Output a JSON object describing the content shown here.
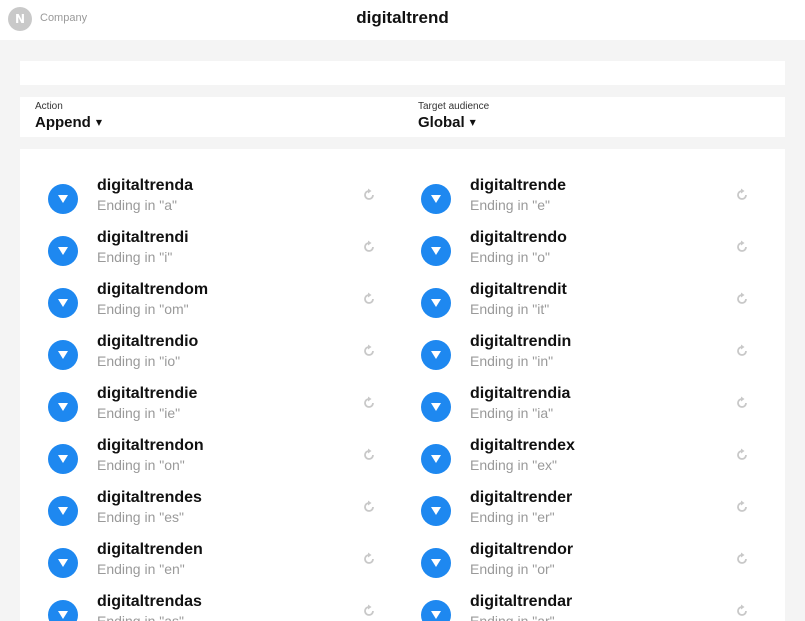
{
  "header": {
    "company": "Company",
    "title": "digitaltrend",
    "logo_letter": "N"
  },
  "filters": {
    "action": {
      "label": "Action",
      "value": "Append"
    },
    "audience": {
      "label": "Target audience",
      "value": "Global"
    }
  },
  "colors": {
    "accent": "#1e88f0",
    "muted": "#9a9a9a",
    "refresh": "#c8c8c8"
  },
  "items": [
    {
      "name": "digitaltrenda",
      "desc": "Ending in \"a\""
    },
    {
      "name": "digitaltrende",
      "desc": "Ending in \"e\""
    },
    {
      "name": "digitaltrendi",
      "desc": "Ending in \"i\""
    },
    {
      "name": "digitaltrendo",
      "desc": "Ending in \"o\""
    },
    {
      "name": "digitaltrendom",
      "desc": "Ending in \"om\""
    },
    {
      "name": "digitaltrendit",
      "desc": "Ending in \"it\""
    },
    {
      "name": "digitaltrendio",
      "desc": "Ending in \"io\""
    },
    {
      "name": "digitaltrendin",
      "desc": "Ending in \"in\""
    },
    {
      "name": "digitaltrendie",
      "desc": "Ending in \"ie\""
    },
    {
      "name": "digitaltrendia",
      "desc": "Ending in \"ia\""
    },
    {
      "name": "digitaltrendon",
      "desc": "Ending in \"on\""
    },
    {
      "name": "digitaltrendex",
      "desc": "Ending in \"ex\""
    },
    {
      "name": "digitaltrendes",
      "desc": "Ending in \"es\""
    },
    {
      "name": "digitaltrender",
      "desc": "Ending in \"er\""
    },
    {
      "name": "digitaltrenden",
      "desc": "Ending in \"en\""
    },
    {
      "name": "digitaltrendor",
      "desc": "Ending in \"or\""
    },
    {
      "name": "digitaltrendas",
      "desc": "Ending in \"as\""
    },
    {
      "name": "digitaltrendar",
      "desc": "Ending in \"ar\""
    }
  ]
}
